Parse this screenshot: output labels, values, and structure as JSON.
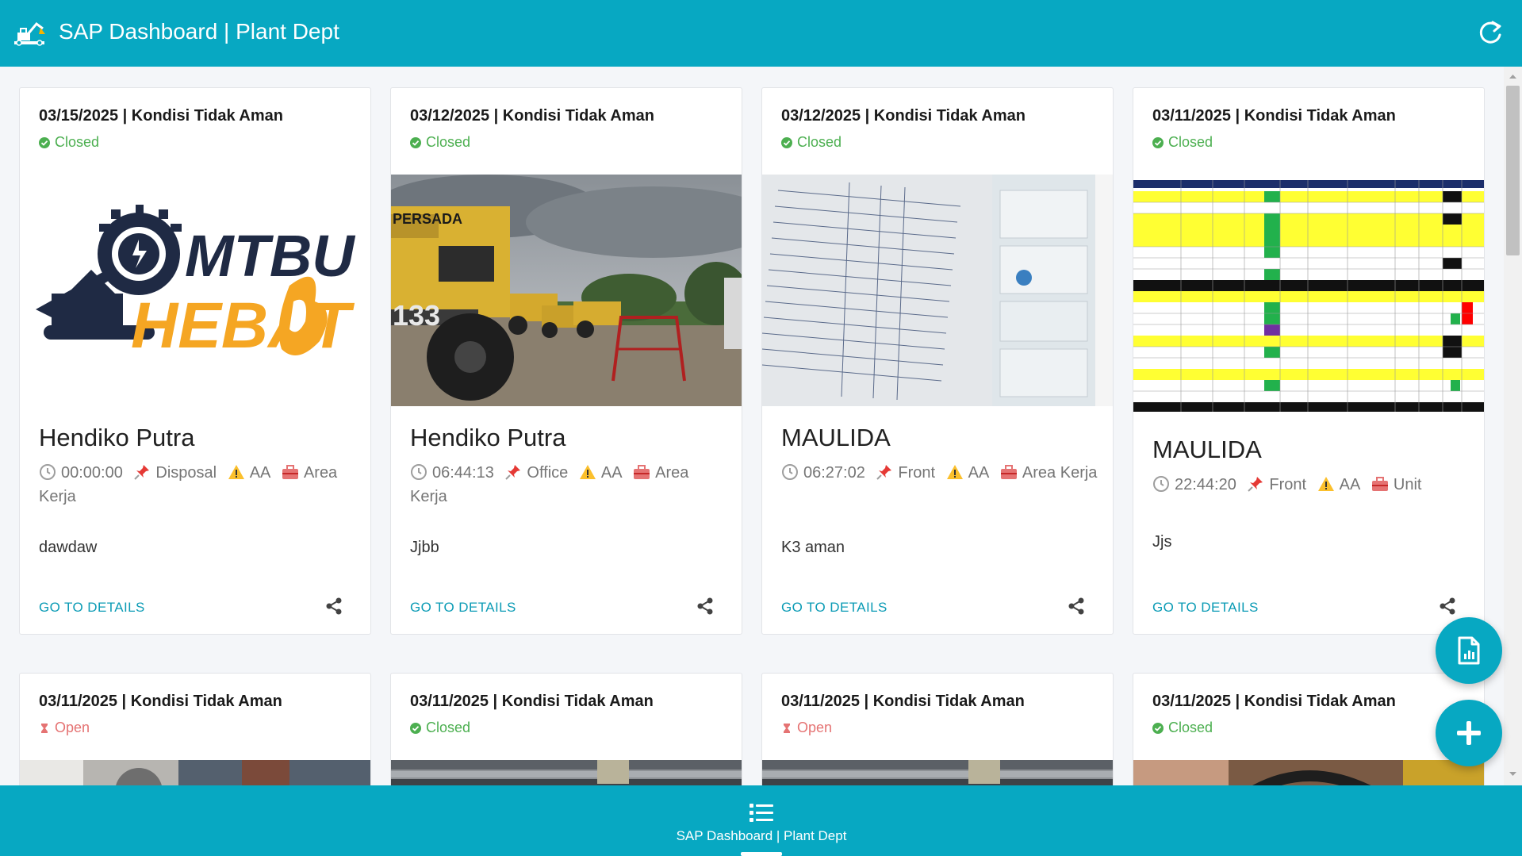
{
  "app": {
    "title": "SAP Dashboard | Plant Dept",
    "colors": {
      "primary": "#07a8c2",
      "closed": "#4caf50",
      "open": "#e57373",
      "link": "#0b9bb5"
    }
  },
  "cards": [
    {
      "header": "03/15/2025 | Kondisi Tidak Aman",
      "status": "Closed",
      "name": "Hendiko Putra",
      "time": "00:00:00",
      "location": "Disposal",
      "risk": "AA",
      "area": "Area Kerja",
      "description": "dawdaw",
      "link": "GO TO DETAILS",
      "image": "mtbu-hebat-logo"
    },
    {
      "header": "03/12/2025 | Kondisi Tidak Aman",
      "status": "Closed",
      "name": "Hendiko Putra",
      "time": "06:44:13",
      "location": "Office",
      "risk": "AA",
      "area": "Area Kerja",
      "description": "Jjbb",
      "link": "GO TO DETAILS",
      "image": "haul-truck-photo"
    },
    {
      "header": "03/12/2025 | Kondisi Tidak Aman",
      "status": "Closed",
      "name": "MAULIDA",
      "time": "06:27:02",
      "location": "Front",
      "risk": "AA",
      "area": "Area Kerja",
      "description": "K3 aman",
      "link": "GO TO DETAILS",
      "image": "first-aid-checklist-photo"
    },
    {
      "header": "03/11/2025 | Kondisi Tidak Aman",
      "status": "Closed",
      "name": "MAULIDA",
      "time": "22:44:20",
      "location": "Front",
      "risk": "AA",
      "area": "Unit",
      "description": "Jjs",
      "link": "GO TO DETAILS",
      "image": "spreadsheet-screenshot"
    },
    {
      "header": "03/11/2025 | Kondisi Tidak Aman",
      "status": "Open",
      "image": "workshop-photo"
    },
    {
      "header": "03/11/2025 | Kondisi Tidak Aman",
      "status": "Closed",
      "image": "pipe-rack-photo"
    },
    {
      "header": "03/11/2025 | Kondisi Tidak Aman",
      "status": "Open",
      "image": "pipe-rack-photo"
    },
    {
      "header": "03/11/2025 | Kondisi Tidak Aman",
      "status": "Closed",
      "image": "hand-tool-photo"
    }
  ],
  "bottom_nav": {
    "label": "SAP Dashboard | Plant Dept",
    "icon": "list-icon"
  },
  "fabs": {
    "report_icon": "document-chart-icon",
    "add_icon": "plus-icon"
  }
}
